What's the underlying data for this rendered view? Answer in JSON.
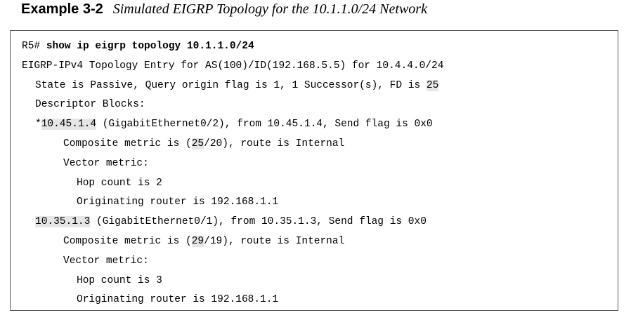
{
  "caption": {
    "number": "Example 3-2",
    "title": "Simulated EIGRP Topology for the 10.1.1.0/24 Network"
  },
  "output": {
    "prompt": "R5# ",
    "command": "show ip eigrp topology 10.1.1.0/24",
    "entry_line": "EIGRP-IPv4 Topology Entry for AS(100)/ID(192.168.5.5) for 10.4.4.0/24",
    "state_prefix": "State is Passive, Query origin flag is 1, 1 Successor(s), FD is ",
    "fd_value": "25",
    "descriptor_blocks": "Descriptor Blocks:",
    "paths": [
      {
        "prefix": "*",
        "next_hop": "10.45.1.4",
        "detail": " (GigabitEthernet0/2), from 10.45.1.4, Send flag is 0x0",
        "composite_prefix": "Composite metric is (",
        "composite_fd": "25",
        "composite_suffix": "/20), route is Internal",
        "vector_metric": "Vector metric:",
        "hop_count": "Hop count is 2",
        "originating_router": "Originating router is 192.168.1.1"
      },
      {
        "prefix": "",
        "next_hop": "10.35.1.3",
        "detail": " (GigabitEthernet0/1), from 10.35.1.3, Send flag is 0x0",
        "composite_prefix": "Composite metric is (",
        "composite_fd": "29",
        "composite_suffix": "/19), route is Internal",
        "vector_metric": "Vector metric:",
        "hop_count": "Hop count is 3",
        "originating_router": "Originating router is 192.168.1.1"
      }
    ]
  }
}
